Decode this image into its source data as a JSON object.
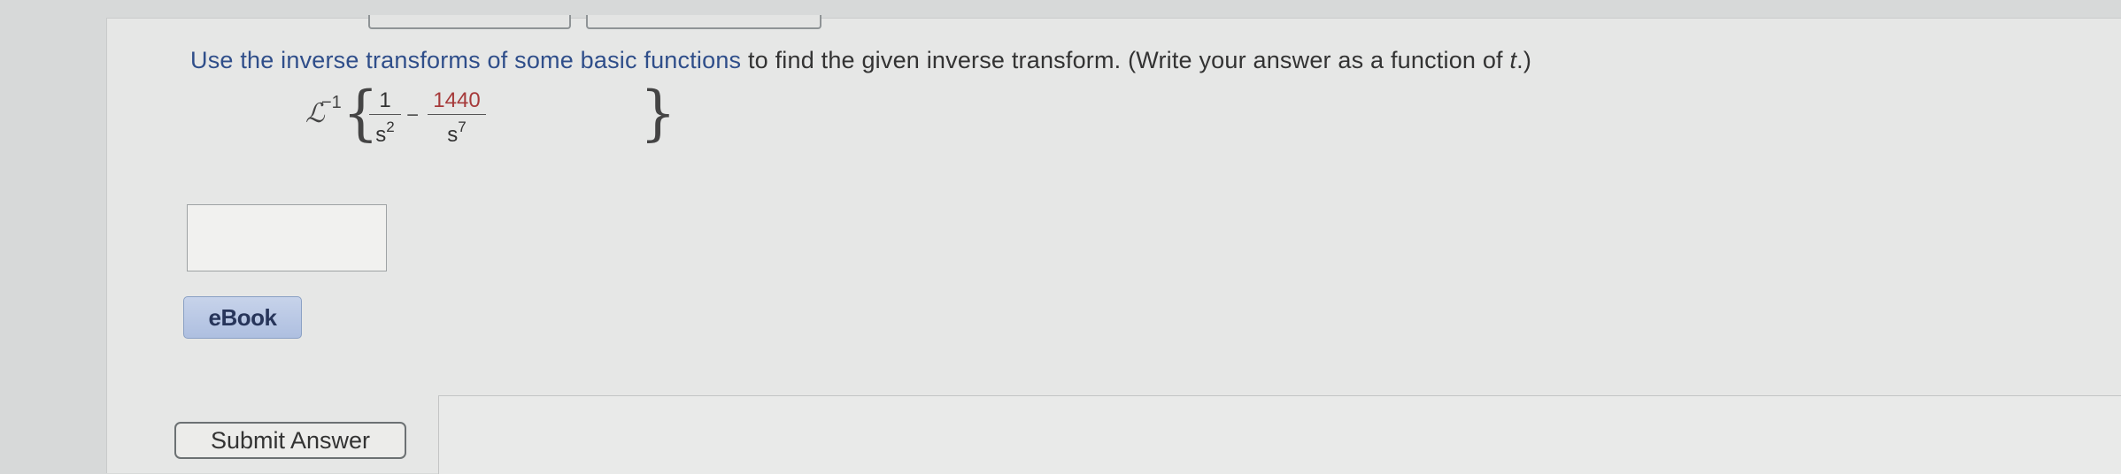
{
  "question": {
    "text_part1": "Use the inverse transforms of some basic functions",
    "text_part2": " to find the given inverse transform. (Write your answer as a function of ",
    "variable": "t",
    "text_end": ".)"
  },
  "formula": {
    "operator": "ℒ",
    "operator_sup": "−1",
    "brace_left": "{",
    "brace_right": "}",
    "term1_num": "1",
    "term1_den_base": "s",
    "term1_den_exp": "2",
    "minus": "−",
    "term2_num": "1440",
    "term2_den_base": "s",
    "term2_den_exp": "7"
  },
  "answer": {
    "value": "",
    "placeholder": ""
  },
  "buttons": {
    "ebook_label": "eBook",
    "submit_label": "Submit Answer"
  },
  "colors": {
    "link_blue": "#2f4e8a",
    "highlight_red": "#a63a3a",
    "ebook_bg": "#b9c8e6"
  }
}
